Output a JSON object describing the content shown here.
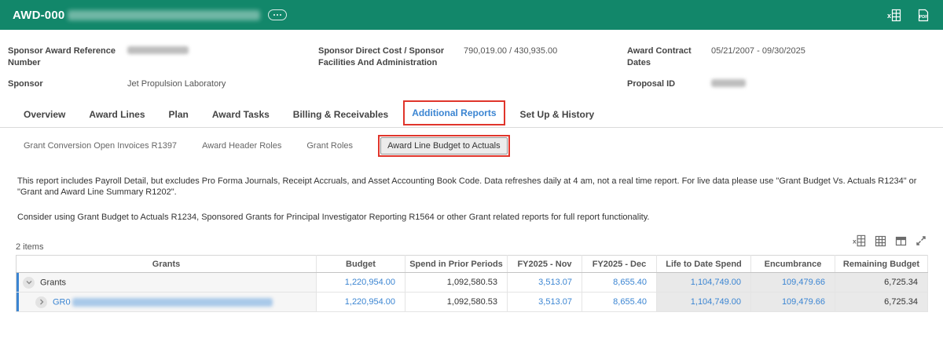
{
  "colors": {
    "header_green": "#12876a",
    "link_blue": "#3b85d2",
    "annotation_red": "#e0352b",
    "shade_gray": "#e9e9e9"
  },
  "header_bar": {
    "title_prefix": "AWD-000",
    "title_rest_redacted": true,
    "icons": [
      "export-excel-icon",
      "export-pdf-icon",
      "related-actions-icon"
    ]
  },
  "summary": {
    "col1": [
      {
        "label": "Sponsor Award Reference Number",
        "value": "",
        "redacted": true
      },
      {
        "label": "Sponsor",
        "value": "Jet Propulsion Laboratory",
        "link": true
      }
    ],
    "col2": [
      {
        "label": "Sponsor Direct Cost / Sponsor Facilities And Administration",
        "value": "790,019.00 / 430,935.00"
      }
    ],
    "col3": [
      {
        "label": "Award Contract Dates",
        "value": "05/21/2007 - 09/30/2025"
      },
      {
        "label": "Proposal ID",
        "value": "",
        "redacted": true
      }
    ]
  },
  "tabs": {
    "items": [
      {
        "label": "Overview",
        "selected": false
      },
      {
        "label": "Award Lines",
        "selected": false
      },
      {
        "label": "Plan",
        "selected": false
      },
      {
        "label": "Award Tasks",
        "selected": false
      },
      {
        "label": "Billing & Receivables",
        "selected": false
      },
      {
        "label": "Additional Reports",
        "selected": true,
        "annotated": true
      },
      {
        "label": "Set Up & History",
        "selected": false
      }
    ]
  },
  "subtabs": {
    "items": [
      {
        "label": "Grant Conversion Open Invoices R1397",
        "selected": false
      },
      {
        "label": "Award Header Roles",
        "selected": false
      },
      {
        "label": "Grant Roles",
        "selected": false
      },
      {
        "label": "Award Line Budget to Actuals",
        "selected": true,
        "annotated": true
      }
    ]
  },
  "notes": {
    "line1": "This report includes Payroll Detail, but excludes Pro Forma Journals, Receipt Accruals, and Asset Accounting Book Code. Data refreshes daily at 4 am, not a real time report. For live data please use \"Grant Budget Vs. Actuals R1234\" or \"Grant and Award Line Summary R1202\".",
    "line2": "Consider using Grant Budget to Actuals R1234, Sponsored Grants for Principal Investigator Reporting R1564 or other Grant related reports for full report functionality."
  },
  "grid": {
    "items_count": "2 items",
    "toolbar_icons": [
      "export-to-excel-icon",
      "grid-view-icon",
      "column-preferences-icon",
      "expand-grid-icon"
    ],
    "headers": [
      "Grants",
      "Budget",
      "Spend in Prior Periods",
      "FY2025 - Nov",
      "FY2025 - Dec",
      "Life to Date Spend",
      "Encumbrance",
      "Remaining Budget"
    ],
    "rows": [
      {
        "label": "Grants",
        "level": 0,
        "expanded": true,
        "label_redacted": false,
        "budget": "1,220,954.00",
        "spend_prior": "1,092,580.53",
        "fy_nov": "3,513.07",
        "fy_dec": "8,655.40",
        "life_to_date": "1,104,749.00",
        "encumbrance": "109,479.66",
        "remaining": "6,725.34"
      },
      {
        "label": "GR0",
        "level": 1,
        "expanded": false,
        "label_redacted": true,
        "budget": "1,220,954.00",
        "spend_prior": "1,092,580.53",
        "fy_nov": "3,513.07",
        "fy_dec": "8,655.40",
        "life_to_date": "1,104,749.00",
        "encumbrance": "109,479.66",
        "remaining": "6,725.34"
      }
    ]
  }
}
